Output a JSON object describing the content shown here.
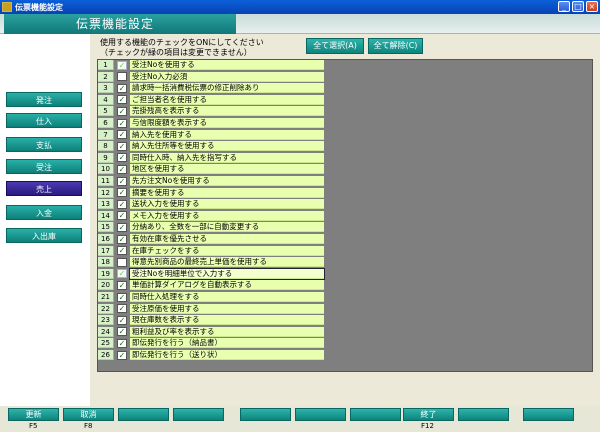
{
  "window": {
    "title": "伝票機能設定"
  },
  "header": {
    "title": "伝票機能設定"
  },
  "instructions": [
    "使用する機能のチェックをONにしてください",
    "（チェックが緑の項目は変更できません）"
  ],
  "buttons": {
    "select_all": "全て選択(A)",
    "clear_all": "全て解除(C)"
  },
  "nav": [
    {
      "label": "発注",
      "active": false
    },
    {
      "label": "仕入",
      "active": false
    },
    {
      "label": "支払",
      "active": false
    },
    {
      "label": "受注",
      "active": false
    },
    {
      "label": "売上",
      "active": true
    },
    {
      "label": "入金",
      "active": false
    },
    {
      "label": "入出庫",
      "active": false
    }
  ],
  "items": [
    {
      "no": "1",
      "label": "受注Noを使用する",
      "checked": true,
      "locked": true
    },
    {
      "no": "2",
      "label": "受注No入力必須",
      "checked": false,
      "locked": false
    },
    {
      "no": "3",
      "label": "請求時一括消費税伝票の修正削除あり",
      "checked": true,
      "locked": false
    },
    {
      "no": "4",
      "label": "ご担当者名を使用する",
      "checked": true,
      "locked": false
    },
    {
      "no": "5",
      "label": "売掛残高を表示する",
      "checked": true,
      "locked": false
    },
    {
      "no": "6",
      "label": "与信限度額を表示する",
      "checked": true,
      "locked": false
    },
    {
      "no": "7",
      "label": "納入先を使用する",
      "checked": true,
      "locked": false
    },
    {
      "no": "8",
      "label": "納入先住所等を使用する",
      "checked": true,
      "locked": false
    },
    {
      "no": "9",
      "label": "同時仕入時、納入先を指写する",
      "checked": true,
      "locked": false
    },
    {
      "no": "10",
      "label": "地区を使用する",
      "checked": true,
      "locked": false
    },
    {
      "no": "11",
      "label": "先方注文Noを使用する",
      "checked": true,
      "locked": false
    },
    {
      "no": "12",
      "label": "摘要を使用する",
      "checked": true,
      "locked": false
    },
    {
      "no": "13",
      "label": "送状入力を使用する",
      "checked": true,
      "locked": false
    },
    {
      "no": "14",
      "label": "メモ入力を使用する",
      "checked": true,
      "locked": false
    },
    {
      "no": "15",
      "label": "分納あり、全数を一部に自動変更する",
      "checked": true,
      "locked": false
    },
    {
      "no": "16",
      "label": "有効在庫を優先させる",
      "checked": true,
      "locked": false
    },
    {
      "no": "17",
      "label": "在庫チェックをする",
      "checked": true,
      "locked": false
    },
    {
      "no": "18",
      "label": "得意先別商品の最終売上単価を使用する",
      "checked": false,
      "locked": false
    },
    {
      "no": "19",
      "label": "受注Noを明細単位で入力する",
      "checked": true,
      "locked": true
    },
    {
      "no": "20",
      "label": "単価計算ダイアログを自動表示する",
      "checked": true,
      "locked": false
    },
    {
      "no": "21",
      "label": "同時仕入処理をする",
      "checked": true,
      "locked": false
    },
    {
      "no": "22",
      "label": "受注原価を使用する",
      "checked": true,
      "locked": false
    },
    {
      "no": "23",
      "label": "現在庫数を表示する",
      "checked": true,
      "locked": false
    },
    {
      "no": "24",
      "label": "粗利益及び率を表示する",
      "checked": true,
      "locked": false
    },
    {
      "no": "25",
      "label": "即伝発行を行う（納品書）",
      "checked": true,
      "locked": false
    },
    {
      "no": "26",
      "label": "即伝発行を行う（送り状）",
      "checked": true,
      "locked": false
    }
  ],
  "footer": {
    "update": "更新",
    "update_key": "F5",
    "cancel": "取消",
    "cancel_key": "F8",
    "exit": "終了",
    "exit_key": "F12"
  }
}
